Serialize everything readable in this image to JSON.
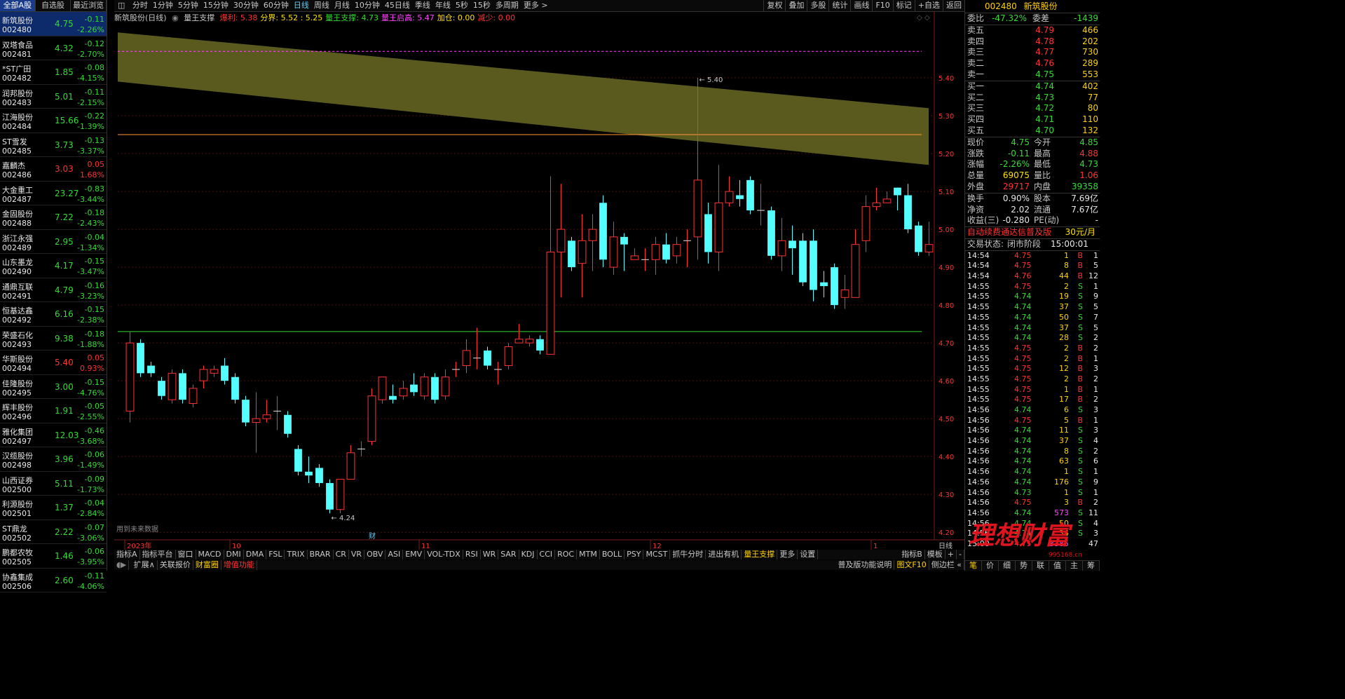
{
  "left_tabs": [
    "全部A股",
    "自选股",
    "最近浏览"
  ],
  "stocks": [
    {
      "name": "新筑股份",
      "code": "002480",
      "price": "4.75",
      "chg": "-0.11",
      "pct": "-2.26%",
      "dir": "dn"
    },
    {
      "name": "双塔食品",
      "code": "002481",
      "price": "4.32",
      "chg": "-0.12",
      "pct": "-2.70%",
      "dir": "dn"
    },
    {
      "name": "*ST广田",
      "code": "002482",
      "price": "1.85",
      "chg": "-0.08",
      "pct": "-4.15%",
      "dir": "dn"
    },
    {
      "name": "润邦股份",
      "code": "002483",
      "price": "5.01",
      "chg": "-0.11",
      "pct": "-2.15%",
      "dir": "dn"
    },
    {
      "name": "江海股份",
      "code": "002484",
      "price": "15.66",
      "chg": "-0.22",
      "pct": "-1.39%",
      "dir": "dn"
    },
    {
      "name": "ST雪发",
      "code": "002485",
      "price": "3.73",
      "chg": "-0.13",
      "pct": "-3.37%",
      "dir": "dn"
    },
    {
      "name": "嘉麟杰",
      "code": "002486",
      "price": "3.03",
      "chg": "0.05",
      "pct": "1.68%",
      "dir": "up"
    },
    {
      "name": "大金重工",
      "code": "002487",
      "price": "23.27",
      "chg": "-0.83",
      "pct": "-3.44%",
      "dir": "dn"
    },
    {
      "name": "金固股份",
      "code": "002488",
      "price": "7.22",
      "chg": "-0.18",
      "pct": "-2.43%",
      "dir": "dn"
    },
    {
      "name": "浙江永强",
      "code": "002489",
      "price": "2.95",
      "chg": "-0.04",
      "pct": "-1.34%",
      "dir": "dn"
    },
    {
      "name": "山东墨龙",
      "code": "002490",
      "price": "4.17",
      "chg": "-0.15",
      "pct": "-3.47%",
      "dir": "dn"
    },
    {
      "name": "通鼎互联",
      "code": "002491",
      "price": "4.79",
      "chg": "-0.16",
      "pct": "-3.23%",
      "dir": "dn"
    },
    {
      "name": "恒基达鑫",
      "code": "002492",
      "price": "6.16",
      "chg": "-0.15",
      "pct": "-2.38%",
      "dir": "dn"
    },
    {
      "name": "荣盛石化",
      "code": "002493",
      "price": "9.38",
      "chg": "-0.18",
      "pct": "-1.88%",
      "dir": "dn"
    },
    {
      "name": "华斯股份",
      "code": "002494",
      "price": "5.40",
      "chg": "0.05",
      "pct": "0.93%",
      "dir": "up"
    },
    {
      "name": "佳隆股份",
      "code": "002495",
      "price": "3.00",
      "chg": "-0.15",
      "pct": "-4.76%",
      "dir": "dn"
    },
    {
      "name": "辉丰股份",
      "code": "002496",
      "price": "1.91",
      "chg": "-0.05",
      "pct": "-2.55%",
      "dir": "dn"
    },
    {
      "name": "雅化集团",
      "code": "002497",
      "price": "12.03",
      "chg": "-0.46",
      "pct": "-3.68%",
      "dir": "dn"
    },
    {
      "name": "汉缆股份",
      "code": "002498",
      "price": "3.96",
      "chg": "-0.06",
      "pct": "-1.49%",
      "dir": "dn"
    },
    {
      "name": "山西证券",
      "code": "002500",
      "price": "5.11",
      "chg": "-0.09",
      "pct": "-1.73%",
      "dir": "dn"
    },
    {
      "name": "利源股份",
      "code": "002501",
      "price": "1.37",
      "chg": "-0.04",
      "pct": "-2.84%",
      "dir": "dn"
    },
    {
      "name": "ST鼎龙",
      "code": "002502",
      "price": "2.22",
      "chg": "-0.07",
      "pct": "-3.06%",
      "dir": "dn"
    },
    {
      "name": "鹏都农牧",
      "code": "002505",
      "price": "1.46",
      "chg": "-0.06",
      "pct": "-3.95%",
      "dir": "dn"
    },
    {
      "name": "协鑫集成",
      "code": "002506",
      "price": "2.60",
      "chg": "-0.11",
      "pct": "-4.06%",
      "dir": "dn"
    }
  ],
  "topbar": {
    "periods": [
      "分时",
      "1分钟",
      "5分钟",
      "15分钟",
      "30分钟",
      "60分钟",
      "日线",
      "周线",
      "月线",
      "10分钟",
      "45日线",
      "季线",
      "年线",
      "5秒",
      "15秒",
      "多周期",
      "更多 >"
    ],
    "active": "日线",
    "right_buttons": [
      "复权",
      "叠加",
      "多股",
      "统计",
      "画线",
      "F10",
      "标记",
      "+自选",
      "返回"
    ]
  },
  "legend": {
    "title": "新筑股份(日线)",
    "indicator": "量王支撑",
    "items": [
      {
        "text": "爆利: 5.38",
        "color": "#ff3333"
      },
      {
        "text": "分界: 5.52 : 5.25",
        "color": "#ffe200"
      },
      {
        "text": "量王支撑: 4.73",
        "color": "#33dd33"
      },
      {
        "text": "量王启高: 5.47",
        "color": "#ff44ff"
      },
      {
        "text": "加仓: 0.00",
        "color": "#ffe200"
      },
      {
        "text": "减少: 0.00",
        "color": "#ff3333"
      }
    ]
  },
  "chart_data": {
    "type": "candlestick",
    "title": "新筑股份(日线)",
    "ylim": [
      4.18,
      5.55
    ],
    "y_ticks": [
      "5.40",
      "5.30",
      "5.20",
      "5.10",
      "5.00",
      "4.90",
      "4.80",
      "4.70",
      "4.60",
      "4.50",
      "4.40",
      "4.30",
      "4.20"
    ],
    "x_labels": [
      {
        "text": "2023年",
        "i": 0
      },
      {
        "text": "10",
        "i": 10
      },
      {
        "text": "11",
        "i": 28
      },
      {
        "text": "12",
        "i": 50
      },
      {
        "text": "1",
        "i": 71
      }
    ],
    "candles": [
      [
        4.52,
        4.7,
        4.49,
        4.73
      ],
      [
        4.7,
        4.62,
        4.61,
        4.71
      ],
      [
        4.64,
        4.62,
        4.61,
        4.65
      ],
      [
        4.6,
        4.56,
        4.55,
        4.61
      ],
      [
        4.55,
        4.62,
        4.54,
        4.63
      ],
      [
        4.62,
        4.55,
        4.54,
        4.63
      ],
      [
        4.54,
        4.58,
        4.53,
        4.59
      ],
      [
        4.6,
        4.63,
        4.58,
        4.64
      ],
      [
        4.62,
        4.63,
        4.61,
        4.64
      ],
      [
        4.64,
        4.6,
        4.59,
        4.66
      ],
      [
        4.61,
        4.55,
        4.54,
        4.62
      ],
      [
        4.55,
        4.49,
        4.48,
        4.56
      ],
      [
        4.49,
        4.5,
        4.41,
        4.57
      ],
      [
        4.5,
        4.51,
        4.49,
        4.55
      ],
      [
        4.52,
        4.52,
        4.47,
        4.56
      ],
      [
        4.51,
        4.46,
        4.45,
        4.52
      ],
      [
        4.42,
        4.36,
        4.35,
        4.43
      ],
      [
        4.36,
        4.35,
        4.33,
        4.4
      ],
      [
        4.37,
        4.33,
        4.32,
        4.38
      ],
      [
        4.33,
        4.26,
        4.25,
        4.34
      ],
      [
        4.26,
        4.34,
        4.25,
        4.34
      ],
      [
        4.34,
        4.41,
        4.36,
        4.43
      ],
      [
        4.42,
        4.42,
        4.4,
        4.44
      ],
      [
        4.44,
        4.56,
        4.43,
        4.58
      ],
      [
        4.55,
        4.61,
        4.54,
        4.61
      ],
      [
        4.56,
        4.55,
        4.54,
        4.59
      ],
      [
        4.56,
        4.58,
        4.55,
        4.6
      ],
      [
        4.59,
        4.57,
        4.56,
        4.62
      ],
      [
        4.56,
        4.61,
        4.55,
        4.62
      ],
      [
        4.61,
        4.55,
        4.54,
        4.62
      ],
      [
        4.56,
        4.61,
        4.55,
        4.63
      ],
      [
        4.63,
        4.63,
        4.61,
        4.65
      ],
      [
        4.64,
        4.68,
        4.62,
        4.71
      ],
      [
        4.66,
        4.66,
        4.63,
        4.74
      ],
      [
        4.68,
        4.64,
        4.63,
        4.69
      ],
      [
        4.63,
        4.63,
        4.59,
        4.65
      ],
      [
        4.64,
        4.69,
        4.63,
        4.7
      ],
      [
        4.7,
        4.71,
        4.7,
        4.75
      ],
      [
        4.7,
        4.71,
        4.69,
        4.72
      ],
      [
        4.71,
        4.68,
        4.67,
        4.72
      ],
      [
        4.67,
        4.94,
        4.67,
        5.14
      ],
      [
        4.94,
        5.0,
        4.82,
        5.12
      ],
      [
        4.97,
        4.9,
        4.89,
        4.98
      ],
      [
        4.91,
        4.97,
        4.82,
        5.04
      ],
      [
        4.97,
        5.0,
        4.89,
        5.04
      ],
      [
        5.07,
        4.92,
        4.9,
        5.09
      ],
      [
        4.9,
        4.98,
        4.88,
        5.02
      ],
      [
        4.98,
        4.96,
        4.89,
        4.99
      ],
      [
        4.92,
        4.93,
        4.92,
        4.95
      ],
      [
        4.92,
        4.92,
        4.89,
        4.95
      ],
      [
        4.92,
        4.96,
        4.88,
        4.98
      ],
      [
        4.96,
        4.92,
        4.91,
        4.99
      ],
      [
        4.93,
        4.96,
        4.91,
        4.98
      ],
      [
        4.97,
        4.97,
        4.9,
        5.0
      ],
      [
        4.98,
        5.13,
        4.92,
        5.4
      ],
      [
        5.04,
        4.94,
        4.91,
        5.07
      ],
      [
        4.94,
        5.07,
        4.89,
        5.17
      ],
      [
        5.07,
        5.1,
        5.06,
        5.14
      ],
      [
        5.09,
        5.08,
        5.06,
        5.13
      ],
      [
        5.13,
        5.05,
        5.04,
        5.14
      ],
      [
        5.05,
        5.05,
        5.01,
        5.12
      ],
      [
        5.05,
        4.93,
        4.92,
        5.06
      ],
      [
        4.93,
        4.97,
        4.89,
        5.03
      ],
      [
        4.97,
        4.95,
        4.88,
        5.01
      ],
      [
        4.97,
        4.86,
        4.85,
        4.99
      ],
      [
        4.97,
        4.84,
        4.81,
        5.0
      ],
      [
        4.86,
        4.85,
        4.82,
        4.89
      ],
      [
        4.9,
        4.8,
        4.79,
        4.91
      ],
      [
        4.82,
        4.84,
        4.79,
        4.88
      ],
      [
        4.82,
        4.96,
        4.82,
        5.0
      ],
      [
        4.97,
        5.06,
        4.94,
        5.09
      ],
      [
        5.06,
        5.07,
        5.05,
        5.11
      ],
      [
        5.07,
        5.08,
        5.07,
        5.1
      ],
      [
        5.11,
        5.09,
        5.05,
        5.11
      ],
      [
        5.09,
        5.0,
        4.99,
        5.12
      ],
      [
        5.01,
        4.94,
        4.93,
        5.02
      ],
      [
        4.94,
        4.96,
        4.93,
        5.02
      ]
    ],
    "max_label": "5.40",
    "min_label": "4.24",
    "hlines": [
      {
        "value": 5.47,
        "color": "#ff44ff",
        "style": "dashed"
      },
      {
        "value": 5.25,
        "color": "#ff9933",
        "style": "solid"
      },
      {
        "value": 4.73,
        "color": "#33dd33",
        "style": "solid"
      }
    ],
    "band": {
      "top_start": 5.52,
      "top_end": 5.32,
      "bot_start": 5.39,
      "bot_end": 5.17,
      "color": "#5a5a1e"
    },
    "note": "用到未来数据",
    "marker": "财"
  },
  "tabs_row1": [
    "指标A",
    "指标平台",
    "窗口",
    "MACD",
    "DMI",
    "DMA",
    "FSL",
    "TRIX",
    "BRAR",
    "CR",
    "VR",
    "OBV",
    "ASI",
    "EMV",
    "VOL-TDX",
    "RSI",
    "WR",
    "SAR",
    "KDJ",
    "CCI",
    "ROC",
    "MTM",
    "BOLL",
    "PSY",
    "MCST",
    "抓牛分时",
    "进出有机",
    "量王支撑",
    "更多",
    "设置"
  ],
  "tabs_row1_active": "量王支撑",
  "tabs_row1_right": [
    "指标B",
    "模板",
    "+",
    "-"
  ],
  "tabs_row2": [
    "扩展∧",
    "关联报价",
    "财富圈",
    "增值功能"
  ],
  "tabs_row2_right": [
    "普及版功能说明",
    "图文F10",
    "侧边栏 «"
  ],
  "period_label": "日线",
  "right": {
    "code": "002480",
    "name": "新筑股份",
    "webi": {
      "l1": "委比",
      "v1": "-47.32%",
      "l2": "委差",
      "v2": "-1439"
    },
    "sell": [
      {
        "l": "卖五",
        "p": "4.79",
        "v": "466",
        "c": "up"
      },
      {
        "l": "卖四",
        "p": "4.78",
        "v": "202",
        "c": "up"
      },
      {
        "l": "卖三",
        "p": "4.77",
        "v": "730",
        "c": "up"
      },
      {
        "l": "卖二",
        "p": "4.76",
        "v": "289",
        "c": "up"
      },
      {
        "l": "卖一",
        "p": "4.75",
        "v": "553",
        "c": "dn"
      }
    ],
    "buy": [
      {
        "l": "买一",
        "p": "4.74",
        "v": "402",
        "c": "dn"
      },
      {
        "l": "买二",
        "p": "4.73",
        "v": "77",
        "c": "dn"
      },
      {
        "l": "买三",
        "p": "4.72",
        "v": "80",
        "c": "dn"
      },
      {
        "l": "买四",
        "p": "4.71",
        "v": "110",
        "c": "dn"
      },
      {
        "l": "买五",
        "p": "4.70",
        "v": "132",
        "c": "dn"
      }
    ],
    "info": [
      {
        "a": "现价",
        "b": "4.75",
        "bc": "dn",
        "c": "今开",
        "d": "4.85",
        "dc": "dn"
      },
      {
        "a": "涨跌",
        "b": "-0.11",
        "bc": "dn",
        "c": "最高",
        "d": "4.88",
        "dc": "up"
      },
      {
        "a": "涨幅",
        "b": "-2.26%",
        "bc": "dn",
        "c": "最低",
        "d": "4.73",
        "dc": "dn"
      },
      {
        "a": "总量",
        "b": "69075",
        "bc": "yl",
        "c": "量比",
        "d": "1.06",
        "dc": "up"
      },
      {
        "a": "外盘",
        "b": "29717",
        "bc": "up",
        "c": "内盘",
        "d": "39358",
        "dc": "dn"
      }
    ],
    "info2": [
      {
        "a": "换手",
        "b": "0.90%",
        "bc": "wh",
        "c": "股本",
        "d": "7.69亿",
        "dc": "wh"
      },
      {
        "a": "净资",
        "b": "2.02",
        "bc": "wh",
        "c": "流通",
        "d": "7.67亿",
        "dc": "wh"
      },
      {
        "a": "收益(三)",
        "b": "-0.280",
        "bc": "wh",
        "c": "PE(动)",
        "d": "-",
        "dc": "wh"
      }
    ],
    "promo": "自动续费通达信普及版",
    "promo_price": "30元/月",
    "status_label": "交易状态:",
    "status_value": "闭市阶段",
    "status_time": "15:00:01",
    "ticks": [
      [
        "14:54",
        "4.75",
        "1",
        "B",
        "1"
      ],
      [
        "14:54",
        "4.75",
        "8",
        "B",
        "5"
      ],
      [
        "14:54",
        "4.76",
        "44",
        "B",
        "12"
      ],
      [
        "14:55",
        "4.75",
        "2",
        "S",
        "1"
      ],
      [
        "14:55",
        "4.74",
        "19",
        "S",
        "9"
      ],
      [
        "14:55",
        "4.74",
        "37",
        "S",
        "5"
      ],
      [
        "14:55",
        "4.74",
        "50",
        "S",
        "7"
      ],
      [
        "14:55",
        "4.74",
        "37",
        "S",
        "5"
      ],
      [
        "14:55",
        "4.74",
        "28",
        "S",
        "2"
      ],
      [
        "14:55",
        "4.75",
        "2",
        "B",
        "2"
      ],
      [
        "14:55",
        "4.75",
        "2",
        "B",
        "1"
      ],
      [
        "14:55",
        "4.75",
        "12",
        "B",
        "3"
      ],
      [
        "14:55",
        "4.75",
        "2",
        "B",
        "2"
      ],
      [
        "14:55",
        "4.75",
        "1",
        "B",
        "1"
      ],
      [
        "14:55",
        "4.75",
        "17",
        "B",
        "2"
      ],
      [
        "14:56",
        "4.74",
        "6",
        "S",
        "3"
      ],
      [
        "14:56",
        "4.75",
        "5",
        "B",
        "1"
      ],
      [
        "14:56",
        "4.74",
        "11",
        "S",
        "3"
      ],
      [
        "14:56",
        "4.74",
        "37",
        "S",
        "4"
      ],
      [
        "14:56",
        "4.74",
        "8",
        "S",
        "2"
      ],
      [
        "14:56",
        "4.74",
        "63",
        "S",
        "6"
      ],
      [
        "14:56",
        "4.74",
        "1",
        "S",
        "1"
      ],
      [
        "14:56",
        "4.74",
        "176",
        "S",
        "9"
      ],
      [
        "14:56",
        "4.73",
        "1",
        "S",
        "1"
      ],
      [
        "14:56",
        "4.75",
        "3",
        "B",
        "2"
      ],
      [
        "14:56",
        "4.74",
        "573",
        "S",
        "11"
      ],
      [
        "14:56",
        "4.74",
        "50",
        "S",
        "4"
      ],
      [
        "14:56",
        "4.74",
        "34",
        "S",
        "3"
      ],
      [
        "15:00",
        "4.75",
        "3385",
        "",
        "47"
      ]
    ],
    "bottom_tabs": [
      "笔",
      "价",
      "细",
      "势",
      "联",
      "值",
      "主",
      "筹"
    ],
    "bottom_active": "笔",
    "watermark": "理想财富",
    "watermark_url": "995168.cn"
  }
}
